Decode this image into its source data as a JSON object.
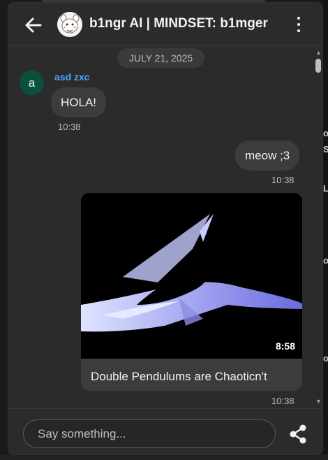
{
  "background": {
    "right_fragments": [
      "o",
      "S",
      "L",
      "o",
      "o"
    ]
  },
  "header": {
    "title": "b1ngr AI | MINDSET: b1mger",
    "back_icon": "arrow-left-icon",
    "menu_icon": "kebab-menu-icon"
  },
  "chat": {
    "date": "JULY 21, 2025",
    "messages": [
      {
        "sender": "asd zxc",
        "avatar_letter": "a",
        "text": "HOLA!",
        "time": "10:38"
      },
      {
        "text": "meow ;3",
        "time": "10:38"
      },
      {
        "video_title": "Double Pendulums are Chaoticn't",
        "duration": "8:58",
        "time": "10:38"
      }
    ]
  },
  "composer": {
    "placeholder": "Say something...",
    "share_icon": "share-icon"
  },
  "colors": {
    "background": "#2b2b2b",
    "bubble": "#3c3c3c",
    "sender_name": "#4aa3ff",
    "avatar": "#0b4f3f"
  }
}
